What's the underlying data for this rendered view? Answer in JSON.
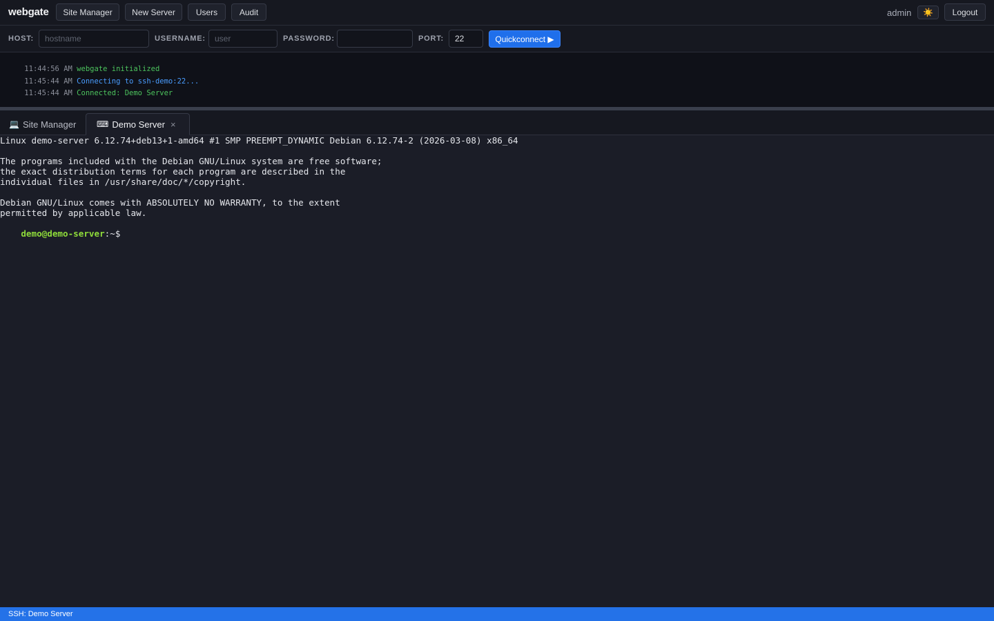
{
  "nav": {
    "brand": "webgate",
    "buttons": [
      "Site Manager",
      "New Server",
      "Users",
      "Audit"
    ],
    "user": "admin",
    "theme_icon": "sun-icon",
    "theme_glyph": "☀️",
    "logout": "Logout"
  },
  "quickconnect": {
    "host_label": "HOST:",
    "host_placeholder": "hostname",
    "username_label": "USERNAME:",
    "username_placeholder": "user",
    "password_label": "PASSWORD:",
    "port_label": "PORT:",
    "port_value": "22",
    "button": "Quickconnect ▶"
  },
  "log": [
    {
      "time": "11:44:56 AM",
      "message": "webgate initialized",
      "level": "ok"
    },
    {
      "time": "11:45:44 AM",
      "message": "Connecting to ssh-demo:22...",
      "level": "info"
    },
    {
      "time": "11:45:44 AM",
      "message": "Connected: Demo Server",
      "level": "ok"
    }
  ],
  "tabs": [
    {
      "icon": "💻",
      "label": "Site Manager"
    },
    {
      "icon": "⌨",
      "label": "Demo Server",
      "close": "×"
    }
  ],
  "terminal": {
    "lines": [
      "Linux demo-server 6.12.74+deb13+1-amd64 #1 SMP PREEMPT_DYNAMIC Debian 6.12.74-2 (2026-03-08) x86_64",
      "",
      "The programs included with the Debian GNU/Linux system are free software;",
      "the exact distribution terms for each program are described in the",
      "individual files in /usr/share/doc/*/copyright.",
      "",
      "Debian GNU/Linux comes with ABSOLUTELY NO WARRANTY, to the extent",
      "permitted by applicable law."
    ],
    "prompt_user": "demo@demo-server",
    "prompt_path": ":~$"
  },
  "status": {
    "text": "SSH: Demo Server"
  },
  "colors": {
    "accent": "#1f6feb",
    "statusbar": "#2472e8",
    "log_ok": "#4cc35d",
    "log_info": "#4a9dff",
    "prompt": "#8fdc3a"
  }
}
